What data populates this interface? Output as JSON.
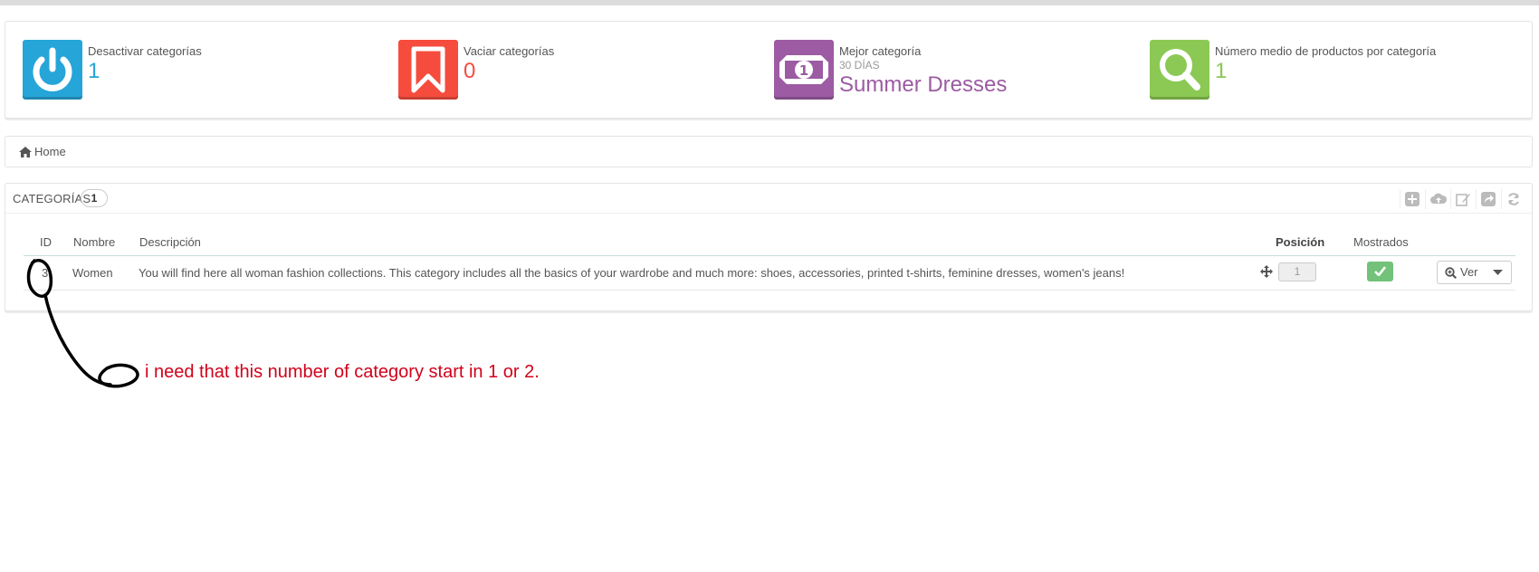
{
  "kpis": [
    {
      "title": "Desactivar categorías",
      "value": "1",
      "color": "#26a5d8",
      "icon": "power-icon"
    },
    {
      "title": "Vaciar categorías",
      "value": "0",
      "color": "#f54c3e",
      "icon": "bookmark-icon"
    },
    {
      "title": "Mejor categoría",
      "subtitle": "30 DÍAS",
      "value": "Summer Dresses",
      "color": "#9c5ba3",
      "icon": "money-icon"
    },
    {
      "title": "Número medio de productos por categoría",
      "value": "1",
      "color": "#8bc954",
      "icon": "search-icon"
    }
  ],
  "breadcrumb": {
    "home_label": "Home",
    "icon": "home-icon"
  },
  "list": {
    "title": "Categorías",
    "count": "1",
    "toolbar_icons": [
      "add-icon",
      "cloud-upload-icon",
      "edit-icon",
      "export-icon",
      "refresh-icon"
    ],
    "columns": {
      "id": "ID",
      "name": "Nombre",
      "description": "Descripción",
      "position": "Posición",
      "shown": "Mostrados"
    },
    "rows": [
      {
        "id": "3",
        "name": "Women",
        "description": "You will find here all woman fashion collections. This category includes all the basics of your wardrobe and much more: shoes, accessories, printed t-shirts, feminine dresses, women's jeans!",
        "position": "1",
        "shown": true
      }
    ],
    "view_label": "Ver"
  },
  "annotation": {
    "text": "i need that this number of category start in 1 or 2.",
    "color": "#d0021b"
  }
}
